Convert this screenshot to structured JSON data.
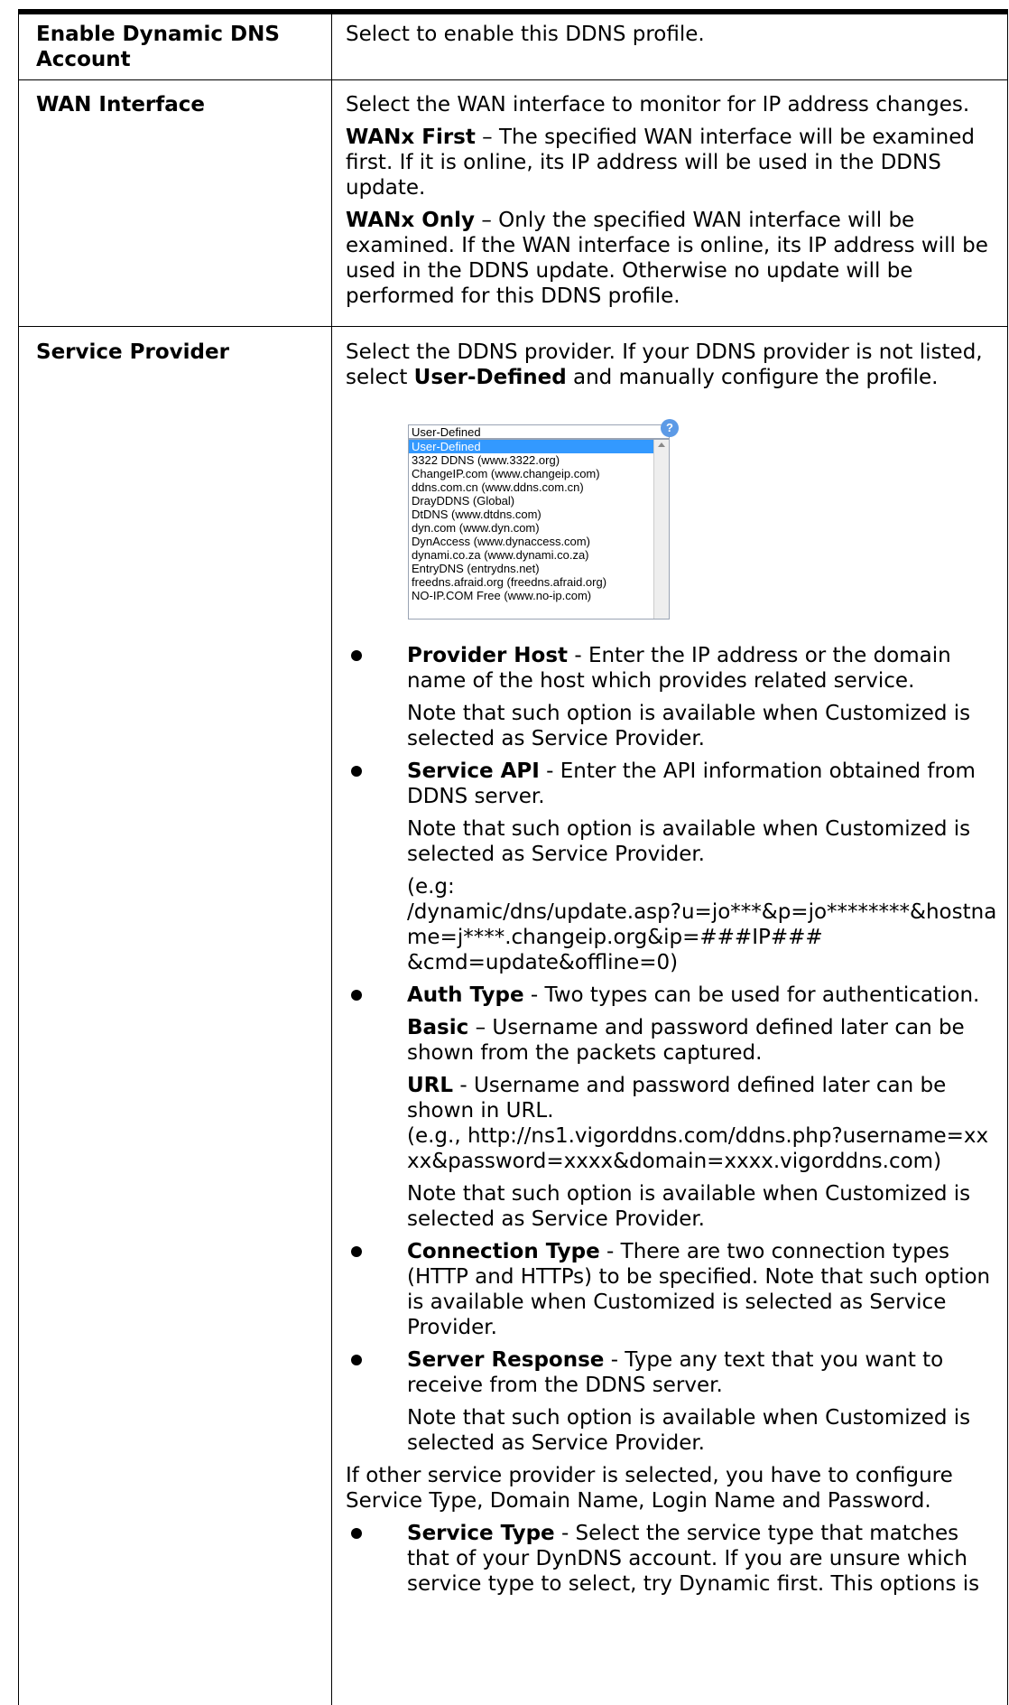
{
  "rows": [
    {
      "label": "Enable Dynamic DNS Account",
      "paragraphs": [
        "Select to enable this DDNS profile."
      ]
    },
    {
      "label": "WAN Interface",
      "paragraphs": [
        "Select the WAN interface to monitor for IP address changes.",
        "The specified WAN interface will be examined first. If it is online, its IP address will be used in the DDNS update.",
        "Only the specified WAN interface will be examined. If the WAN interface is online, its IP address will be used in the DDNS update. Otherwise no update will be performed for this DDNS profile."
      ],
      "terms": [
        "WANx First",
        "WANx Only"
      ]
    },
    {
      "label": "Service Provider",
      "intro_pre": "Select the DDNS provider. If your DDNS provider is not listed, select ",
      "intro_bold": "User-Defined",
      "intro_post": " and manually configure the profile."
    }
  ],
  "dropdown": {
    "selected": "User-Defined",
    "options": [
      "User-Defined",
      "3322 DDNS (www.3322.org)",
      "ChangeIP.com (www.changeip.com)",
      "ddns.com.cn (www.ddns.com.cn)",
      "DrayDDNS (Global)",
      "DtDNS (www.dtdns.com)",
      "dyn.com (www.dyn.com)",
      "DynAccess (www.dynaccess.com)",
      "dynami.co.za (www.dynami.co.za)",
      "EntryDNS (entrydns.net)",
      "freedns.afraid.org (freedns.afraid.org)",
      "NO-IP.COM Free (www.no-ip.com)"
    ],
    "help_glyph": "?"
  },
  "bullets": {
    "note": "Note that such option is available when Customized is selected as Service Provider.",
    "provider_host": {
      "term": "Provider Host",
      "text": " - Enter the IP address or the domain name of the host which provides related service."
    },
    "service_api": {
      "term": "Service API",
      "text": " - Enter the API information obtained from DDNS server."
    },
    "api_example_1": "(e.g:",
    "api_example_2": "/dynamic/dns/update.asp?u=jo***&p=jo********&hostname=j****.changeip.org&ip=###IP###",
    "api_example_3": "&cmd=update&offline=0)",
    "auth_type": {
      "term": "Auth Type",
      "text": " - Two types can be used for authentication."
    },
    "basic": {
      "term": "Basic",
      "text": " – Username and password defined later can be shown from the packets captured."
    },
    "url": {
      "term": "URL",
      "text": " - Username and password defined later can be shown in URL."
    },
    "url_example": "(e.g., http://ns1.vigorddns.com/ddns.php?username=xxxx&password=xxxx&domain=xxxx.vigorddns.com)",
    "connection_type": {
      "term": "Connection Type",
      "text": " - There are two connection types (HTTP and HTTPs) to be specified. Note that such option is available when Customized is selected as Service Provider."
    },
    "server_response": {
      "term": "Server Response",
      "text": " - Type any text that you want to receive from the DDNS server."
    },
    "other_provider": "If other service provider is selected, you have to configure Service Type, Domain Name, Login Name and Password.",
    "service_type": {
      "term": "Service Type",
      "text": " - Select the service type that matches that of your DynDNS account. If you are unsure which service type to select, try Dynamic first. This options is"
    }
  }
}
